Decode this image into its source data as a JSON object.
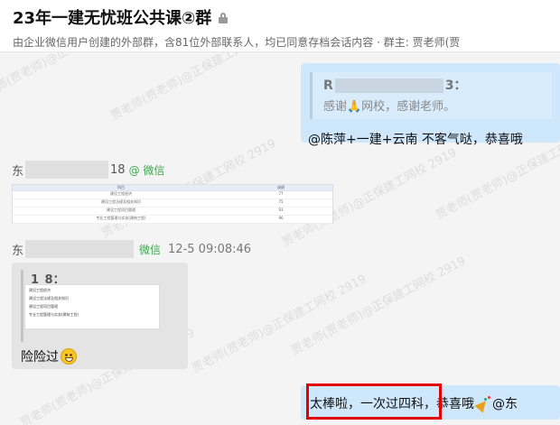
{
  "header": {
    "title": "23年一建无忧班公共课②群",
    "subtitle": "由企业微信用户创建的外部群，含81位外部联系人，均已同意存档会话内容 · 群主: 贾老师(贾"
  },
  "watermark": "贾老师(贾老师)@正保建工网校 2919",
  "messages": {
    "m1": {
      "quote_author_start": "R",
      "quote_author_end": "3：",
      "quote_text": "感谢🙏网校，感谢老师。",
      "reply": "@陈萍+一建+云南  不客气哒，恭喜哦"
    },
    "m2": {
      "sender_start": "东",
      "sender_end": "18",
      "tag": "@ 微信",
      "table": {
        "columns": [
          "科目",
          "成绩"
        ],
        "rows": [
          [
            "建设工程经济",
            "77"
          ],
          [
            "建设工程法规及相关知识",
            "75"
          ],
          [
            "建设工程项目管理",
            "93"
          ],
          [
            "专业工程管理与实务(建筑工程)",
            "96"
          ]
        ]
      }
    },
    "m3": {
      "sender_start": "东",
      "tag": "微信",
      "time": "12-5 09:08:46",
      "quote_name": "1_8：",
      "msg": "险险过"
    },
    "m4": {
      "msg_highlight": "太棒啦，一次过四科",
      "msg_rest": "，恭喜哦",
      "mention": "@东"
    }
  }
}
